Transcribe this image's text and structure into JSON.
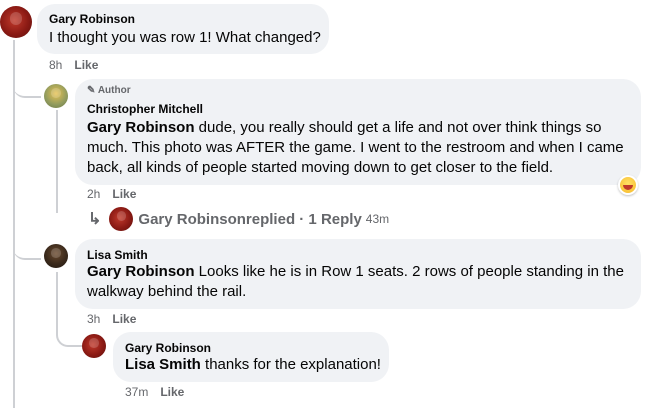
{
  "comments": [
    {
      "author": "Gary Robinson",
      "text": "I thought you was row 1! What changed?",
      "time": "8h",
      "like": "Like"
    },
    {
      "badge": "Author",
      "author": "Christopher Mitchell",
      "mention": "Gary Robinson",
      "text": " dude, you really should get a life and not over think things so much. This photo was AFTER the game. I went to the restroom and when I came back, all kinds of people started moving down to get closer to the field.",
      "time": "2h",
      "like": "Like",
      "replies": {
        "name": "Gary Robinson",
        "label": " replied · 1 Reply",
        "time": "43m"
      }
    },
    {
      "author": "Lisa Smith",
      "mention": "Gary Robinson",
      "text": " Looks like he is in Row 1 seats. 2 rows of people standing in the walkway behind the rail.",
      "time": "3h",
      "like": "Like"
    },
    {
      "author": "Gary Robinson",
      "mention": "Lisa Smith",
      "text": " thanks for the explanation!",
      "time": "37m",
      "like": "Like"
    }
  ],
  "colors": {
    "bubble": "#f0f2f5",
    "meta": "#65676b",
    "thread_line": "#ced0d4"
  }
}
